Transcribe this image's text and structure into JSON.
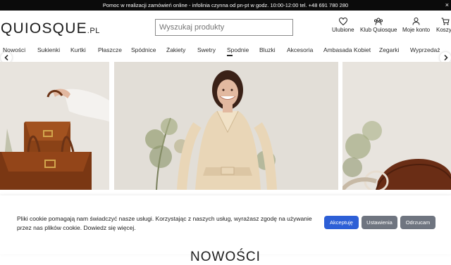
{
  "topbar": {
    "message": "Pomoc w realizacji zamówień online - infolinia czynna od pn-pt w godz. 10:00-12:00 tel. +48 691 780 280",
    "close_label": "×"
  },
  "header": {
    "logo_main": "QUIOSQUE",
    "logo_suffix": ".PL",
    "search_placeholder": "Wyszukaj produkty",
    "icons": [
      {
        "label": "Ulubione",
        "icon": "heart-icon"
      },
      {
        "label": "Klub Quiosque",
        "icon": "club-icon"
      },
      {
        "label": "Moje konto",
        "icon": "user-icon"
      },
      {
        "label": "Koszyk",
        "icon": "cart-icon"
      }
    ]
  },
  "nav": {
    "items": [
      "Nowości",
      "Sukienki",
      "Kurtki",
      "Płaszcze",
      "Spódnice",
      "Żakiety",
      "Swetry",
      "Spodnie",
      "Bluzki",
      "Akcesoria",
      "Ambasada Kobiet",
      "Zegarki",
      "Wyprzedaż"
    ],
    "active": "Spodnie"
  },
  "cookie": {
    "text": "Pliki cookie pomagają nam świadczyć nasze usługi. Korzystając z naszych usług, wyrażasz zgodę na używanie przez nas plików cookie. Dowiedz się więcej.",
    "accept": "Akceptuję",
    "settings": "Ustawienia",
    "reject": "Odrzucam"
  },
  "section": {
    "title": "NOWOŚCI"
  },
  "colors": {
    "topbar_bg": "#0b0b0b",
    "accept_button": "#2d5fd6",
    "secondary_button": "#6f7580",
    "slide_background": "#e6e2dc"
  }
}
